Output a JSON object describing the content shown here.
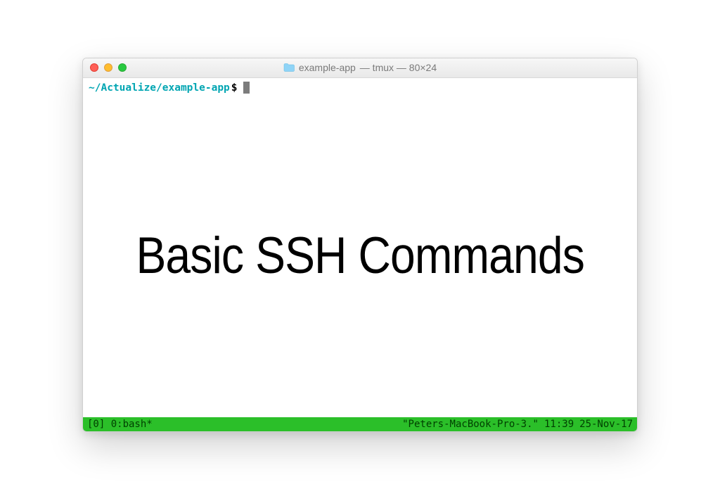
{
  "window": {
    "title_folder": "example-app",
    "title_suffix": "— tmux — 80×24"
  },
  "prompt": {
    "path": "~/Actualize/example-app",
    "symbol": "$"
  },
  "heading": "Basic SSH Commands",
  "tmux": {
    "left": "[0] 0:bash*",
    "host": "\"Peters-MacBook-Pro-3.\"",
    "time": "11:39",
    "date": "25-Nov-17"
  }
}
